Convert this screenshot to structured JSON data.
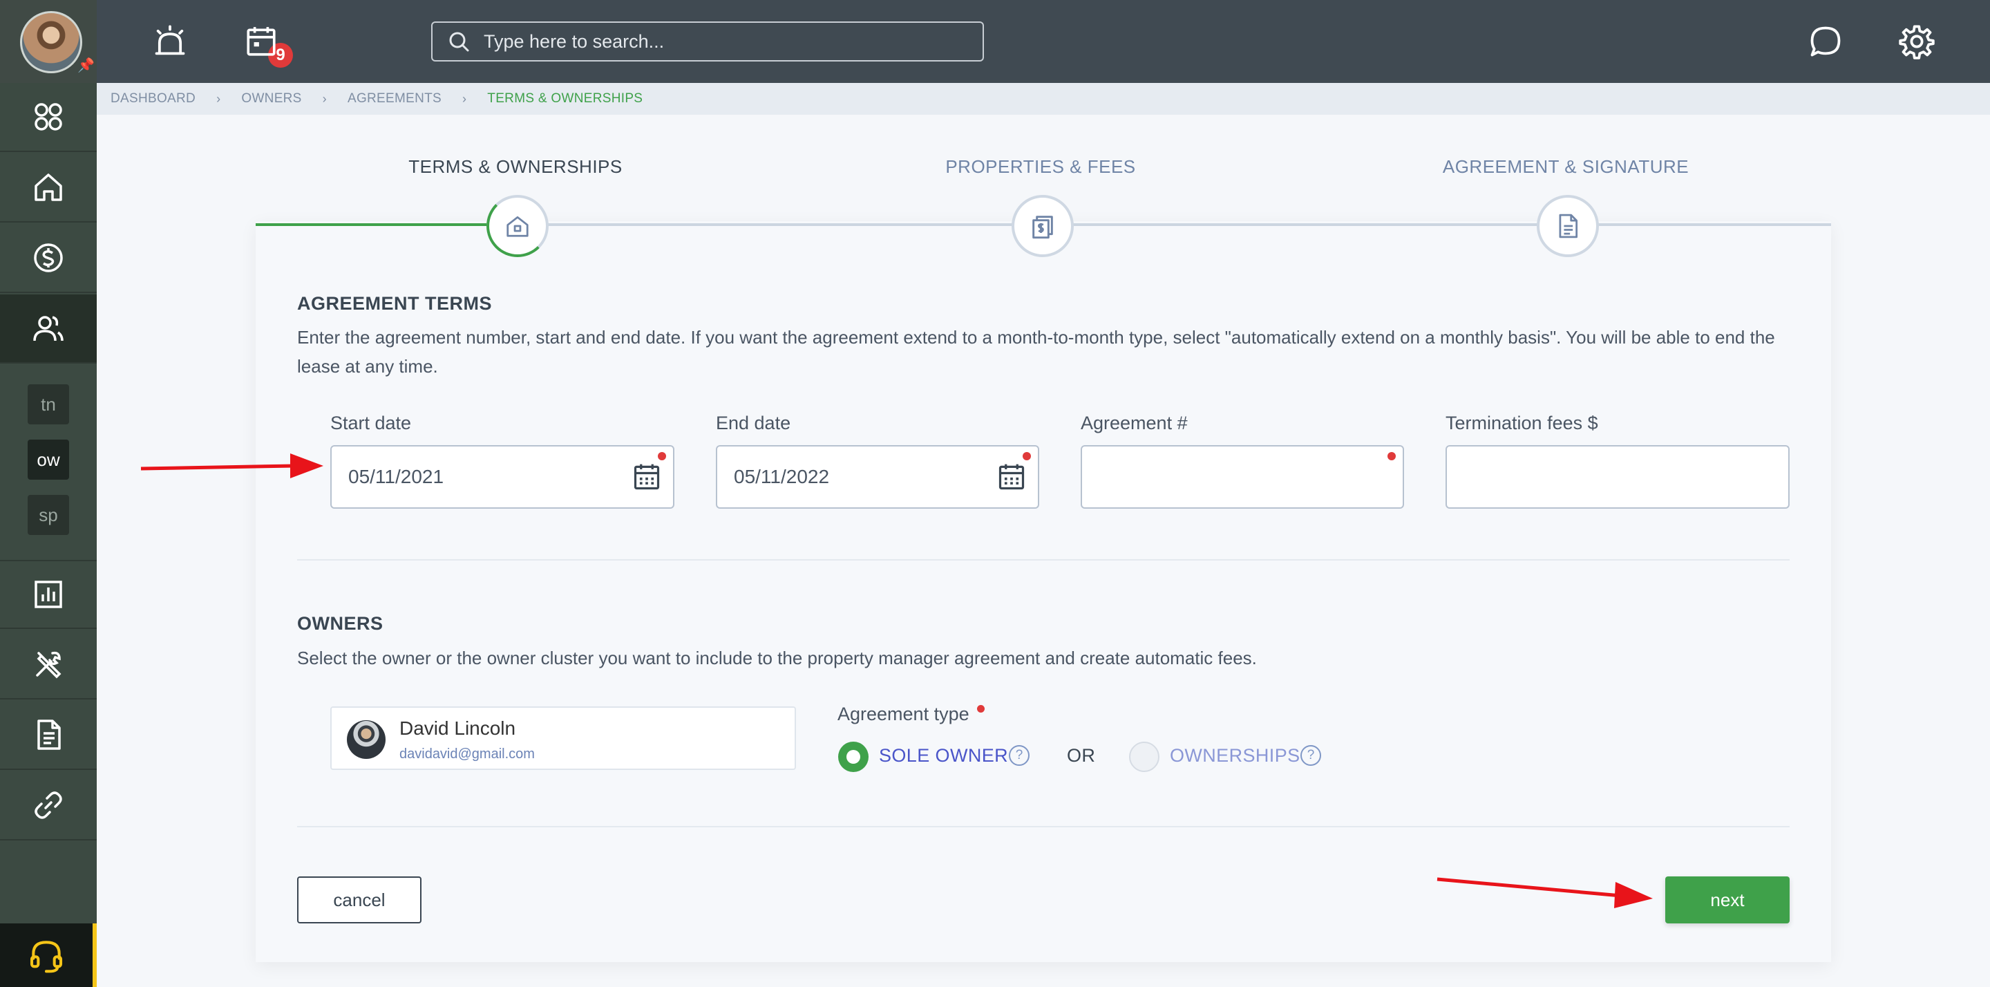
{
  "topbar": {
    "notifications_count": "9",
    "search_placeholder": "Type here to search..."
  },
  "sidebar": {
    "tags": [
      "tn",
      "ow",
      "sp"
    ]
  },
  "breadcrumb": {
    "items": [
      "DASHBOARD",
      "OWNERS",
      "AGREEMENTS"
    ],
    "current": "TERMS & OWNERSHIPS"
  },
  "stepper": {
    "steps": [
      "TERMS & OWNERSHIPS",
      "PROPERTIES & FEES",
      "AGREEMENT & SIGNATURE"
    ]
  },
  "terms": {
    "title": "AGREEMENT TERMS",
    "description": "Enter the agreement number, start and end date. If you want the agreement extend to a month-to-month type, select \"automatically extend on a monthly basis\". You will be able to end the lease at any time.",
    "start_label": "Start date",
    "start_value": "05/11/2021",
    "end_label": "End date",
    "end_value": "05/11/2022",
    "agreement_label": "Agreement #",
    "agreement_value": "",
    "termination_label": "Termination fees $",
    "termination_value": ""
  },
  "owners": {
    "title": "OWNERS",
    "description": "Select the owner or the owner cluster you want to include to the property manager agreement and create automatic fees.",
    "owner_name": "David Lincoln",
    "owner_email": "davidavid@gmail.com",
    "agreement_type_label": "Agreement type",
    "option_sole": "SOLE OWNER",
    "or_text": "OR",
    "option_ownerships": "OWNERSHIPS",
    "help_glyph": "?"
  },
  "actions": {
    "cancel": "cancel",
    "next": "next"
  },
  "colors": {
    "accent_green": "#3fa14a",
    "topbar": "#404a52",
    "sidebar": "#3c4a42",
    "required_dot": "#e03a3a",
    "annotation_arrow": "#e8141a"
  }
}
